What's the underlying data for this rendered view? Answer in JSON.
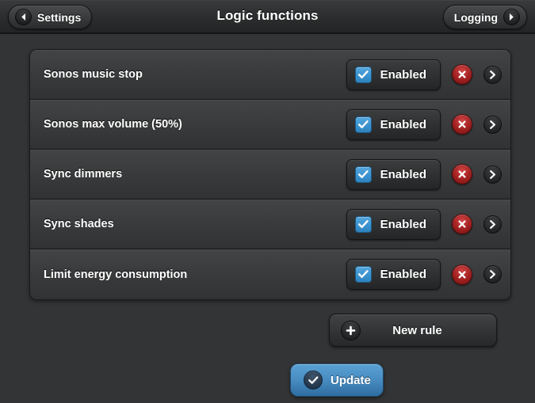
{
  "header": {
    "title": "Logic functions",
    "back_button": {
      "label": "Settings",
      "icon": "chevron-left-icon"
    },
    "forward_button": {
      "label": "Logging",
      "icon": "chevron-right-icon"
    }
  },
  "rules": [
    {
      "label": "Sonos music stop",
      "toggle_label": "Enabled",
      "checked": true
    },
    {
      "label": "Sonos max volume (50%)",
      "toggle_label": "Enabled",
      "checked": true
    },
    {
      "label": "Sync dimmers",
      "toggle_label": "Enabled",
      "checked": true
    },
    {
      "label": "Sync shades",
      "toggle_label": "Enabled",
      "checked": true
    },
    {
      "label": "Limit energy consumption",
      "toggle_label": "Enabled",
      "checked": true
    }
  ],
  "actions": {
    "new_rule_label": "New rule",
    "new_rule_icon": "plus-icon",
    "update_label": "Update",
    "update_icon": "check-circle-icon"
  },
  "icons": {
    "delete": "delete-x-icon",
    "detail": "chevron-right-icon",
    "checkbox": "checkmark-icon"
  },
  "colors": {
    "page_background": "#333435",
    "header_background": "#2e2f30",
    "row_background": "#3b3c3d",
    "checkbox_blue": "#3a93d0",
    "delete_red": "#a11f1f",
    "update_blue": "#4a8fc4",
    "text": "#ffffff"
  }
}
